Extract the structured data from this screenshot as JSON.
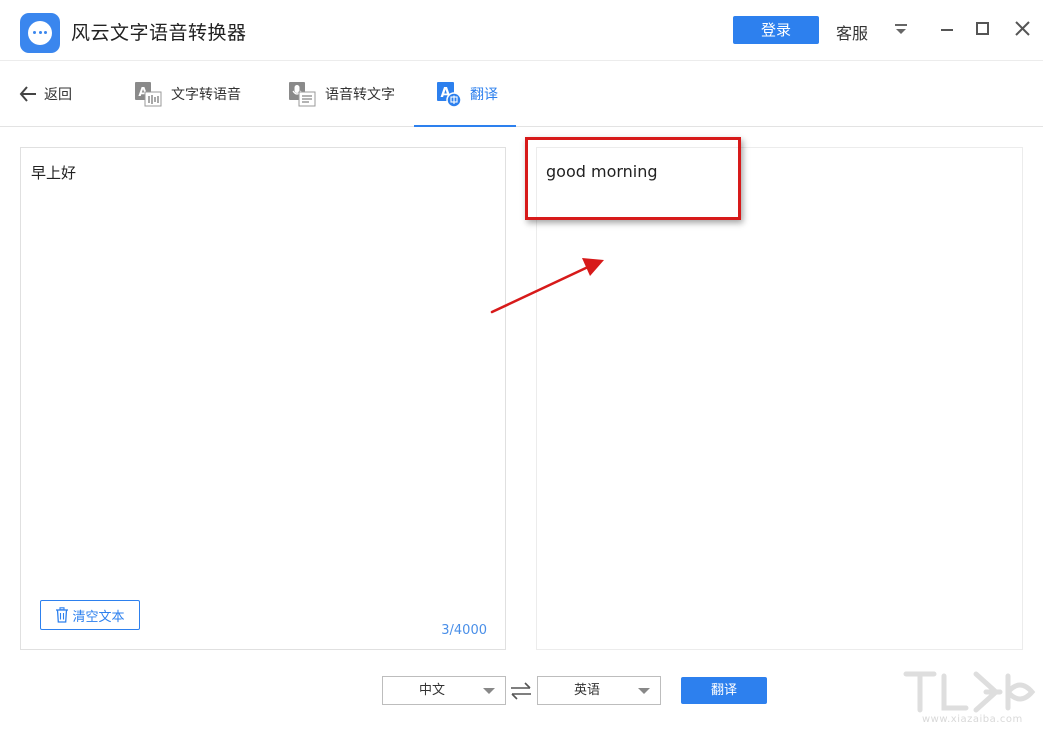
{
  "app": {
    "title": "风云文字语音转换器",
    "login_label": "登录",
    "service_label": "客服"
  },
  "nav": {
    "back_label": "返回",
    "tabs": [
      {
        "label": "文字转语音",
        "icon": "text-to-speech-icon",
        "active": false
      },
      {
        "label": "语音转文字",
        "icon": "speech-to-text-icon",
        "active": false
      },
      {
        "label": "翻译",
        "icon": "translate-icon",
        "active": true
      }
    ]
  },
  "source": {
    "text": "早上好",
    "clear_label": "清空文本",
    "char_count": "3/4000"
  },
  "result": {
    "text": "good morning"
  },
  "controls": {
    "from_language": "中文",
    "to_language": "英语",
    "translate_label": "翻译"
  },
  "watermark": {
    "url": "www.xiazaiba.com"
  },
  "colors": {
    "accent": "#2d80ee",
    "annotation_red": "#d71a1a"
  }
}
